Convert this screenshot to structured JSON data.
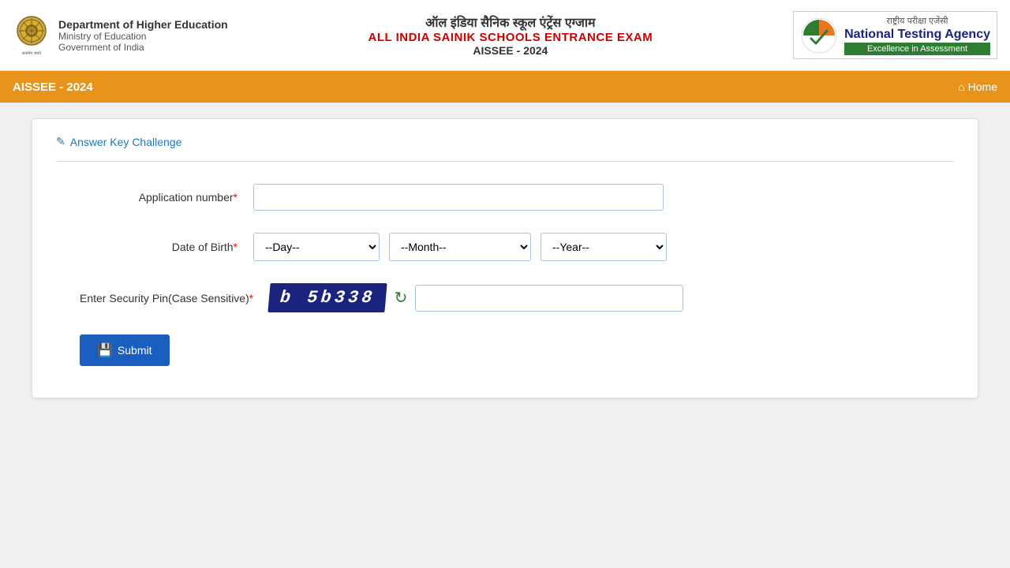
{
  "header": {
    "dept_line1": "Department of Higher Education",
    "dept_line2": "Ministry of Education",
    "dept_line3": "Government of India",
    "hindi_title": "ऑल इंडिया सैनिक स्कूल एंट्रेंस एग्जाम",
    "eng_title": "ALL INDIA SAINIK SCHOOLS ENTRANCE EXAM",
    "year_title": "AISSEE - 2024",
    "nta_label": "राष्ट्रीय परीक्षा एजेंसी",
    "nta_title": "National Testing Agency",
    "nta_subtitle": "Excellence in Assessment"
  },
  "navbar": {
    "brand": "AISSEE - 2024",
    "home_label": "Home"
  },
  "form": {
    "answer_key_link": "Answer Key Challenge",
    "app_number_label": "Application number",
    "app_number_placeholder": "",
    "dob_label": "Date of Birth",
    "day_default": "--Day--",
    "month_default": "--Month--",
    "year_default": "--Year--",
    "security_pin_label": "Enter Security Pin(Case Sensitive)",
    "captcha_text": "b 5b338",
    "security_pin_placeholder": "",
    "submit_label": "Submit"
  }
}
